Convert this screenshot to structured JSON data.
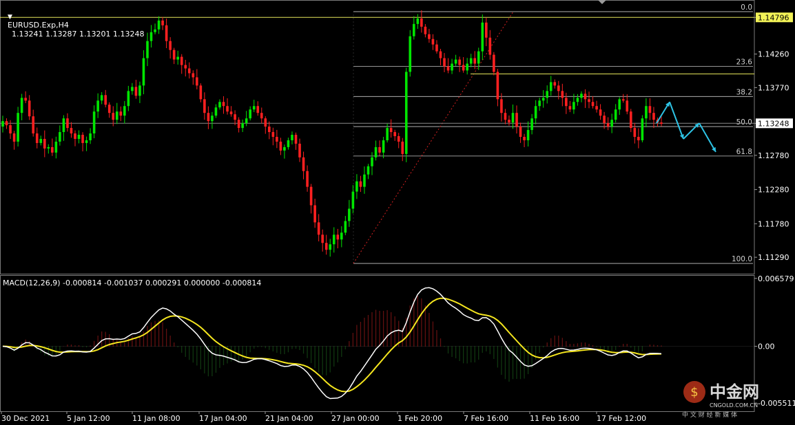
{
  "header": {
    "symbol": "EURUSD.Exp,H4",
    "ohlc": "1.13241 1.13287 1.13201 1.13248"
  },
  "macd_header": "MACD(12,26,9) -0.000814 -0.001037 0.000291 0.000000 -0.000814",
  "watermark": {
    "brand": "中金网",
    "domain": "CNGOLD.COM.CN",
    "tagline": "中 文 财 经 新 媒 体"
  },
  "chart_data": [
    {
      "type": "candlestick",
      "name": "price",
      "ylim": [
        1.1105,
        1.1505
      ],
      "y_ticks": [
        "1.14796",
        "1.14260",
        "1.13770",
        "1.13248",
        "1.12780",
        "1.12280",
        "1.11780",
        "1.11290"
      ],
      "price_labels": {
        "resistance": "1.14796",
        "current": "1.13248"
      },
      "x_ticks": [
        "30 Dec 2021",
        "5 Jan 12:00",
        "11 Jan 08:00",
        "17 Jan 04:00",
        "21 Jan 04:00",
        "27 Jan 00:00",
        "1 Feb 20:00",
        "7 Feb 16:00",
        "11 Feb 16:00",
        "17 Feb 12:00"
      ],
      "horizontal_lines": [
        1.14796,
        1.1397,
        1.13248
      ],
      "fibonacci": {
        "levels": [
          {
            "label": "0.0",
            "price": 1.1488
          },
          {
            "label": "23.6",
            "price": 1.1408
          },
          {
            "label": "38.2",
            "price": 1.1364
          },
          {
            "label": "50.0",
            "price": 1.132
          },
          {
            "label": "61.8",
            "price": 1.1277
          },
          {
            "label": "100.0",
            "price": 1.112
          }
        ]
      },
      "colors": {
        "up": "#00e600",
        "down": "#ff2020",
        "level": "#c9c9c9",
        "resistance": "#e6e65a",
        "forecast": "#2ec4e6"
      },
      "closes": [
        1.1328,
        1.1322,
        1.131,
        1.1298,
        1.134,
        1.1362,
        1.1358,
        1.1335,
        1.131,
        1.1296,
        1.1302,
        1.1288,
        1.129,
        1.1282,
        1.1298,
        1.1312,
        1.1332,
        1.1318,
        1.131,
        1.1302,
        1.1308,
        1.1296,
        1.13,
        1.131,
        1.1342,
        1.1358,
        1.1366,
        1.1352,
        1.134,
        1.133,
        1.1342,
        1.1336,
        1.135,
        1.1372,
        1.1378,
        1.1365,
        1.138,
        1.142,
        1.1445,
        1.1458,
        1.1462,
        1.1475,
        1.1468,
        1.1445,
        1.1432,
        1.1418,
        1.1422,
        1.141,
        1.1405,
        1.1398,
        1.1392,
        1.138,
        1.136,
        1.134,
        1.1328,
        1.1336,
        1.1348,
        1.1356,
        1.135,
        1.1342,
        1.1338,
        1.133,
        1.1318,
        1.1325,
        1.1332,
        1.1345,
        1.135,
        1.134,
        1.1332,
        1.132,
        1.1312,
        1.1305,
        1.1298,
        1.1285,
        1.129,
        1.13,
        1.1308,
        1.1295,
        1.1275,
        1.1255,
        1.1232,
        1.1205,
        1.118,
        1.1162,
        1.115,
        1.114,
        1.1148,
        1.1162,
        1.1155,
        1.1165,
        1.1182,
        1.12,
        1.1225,
        1.124,
        1.1232,
        1.125,
        1.1262,
        1.1275,
        1.129,
        1.1282,
        1.13,
        1.1318,
        1.1312,
        1.1306,
        1.1298,
        1.128,
        1.14,
        1.1452,
        1.147,
        1.1478,
        1.1466,
        1.1455,
        1.1448,
        1.144,
        1.143,
        1.142,
        1.1408,
        1.1402,
        1.1412,
        1.1418,
        1.141,
        1.1402,
        1.1412,
        1.142,
        1.1412,
        1.143,
        1.1472,
        1.145,
        1.1425,
        1.14,
        1.136,
        1.134,
        1.133,
        1.1326,
        1.134,
        1.132,
        1.1305,
        1.13,
        1.1315,
        1.1332,
        1.135,
        1.1358,
        1.1362,
        1.1372,
        1.1385,
        1.138,
        1.1372,
        1.1362,
        1.135,
        1.1345,
        1.1356,
        1.1362,
        1.1368,
        1.136,
        1.1356,
        1.135,
        1.1345,
        1.1336,
        1.1325,
        1.132,
        1.133,
        1.1345,
        1.136,
        1.1358,
        1.1342,
        1.1318,
        1.1305,
        1.13,
        1.1332,
        1.135,
        1.134,
        1.133,
        1.1326,
        1.1324
      ],
      "forecast_path": [
        1.1325,
        1.1356,
        1.1302,
        1.1325,
        1.1283
      ]
    },
    {
      "type": "macd",
      "name": "MACD(12,26,9)",
      "ylim": [
        -0.0063,
        0.0069
      ],
      "y_ticks": [
        "0.006579",
        "0.00",
        "-0.005511"
      ],
      "colors": {
        "macd": "#ffffff",
        "signal": "#f5e61e",
        "hist_up": "#c21f1f",
        "hist_down": "#1f6e1f"
      }
    }
  ]
}
